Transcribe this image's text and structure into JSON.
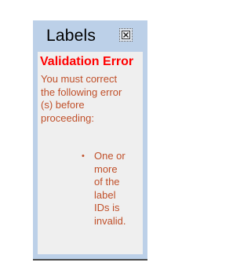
{
  "panel": {
    "title": "Labels",
    "close_icon": "close-icon"
  },
  "validation": {
    "title": "Validation Error",
    "message": "You must correct the following error (s) before proceeding:",
    "errors": [
      "One or more of the label IDs is invalid."
    ]
  },
  "colors": {
    "panel_bg": "#bcd0e8",
    "content_bg": "#efefef",
    "error_title": "#ff0000",
    "error_text": "#c0502a"
  }
}
